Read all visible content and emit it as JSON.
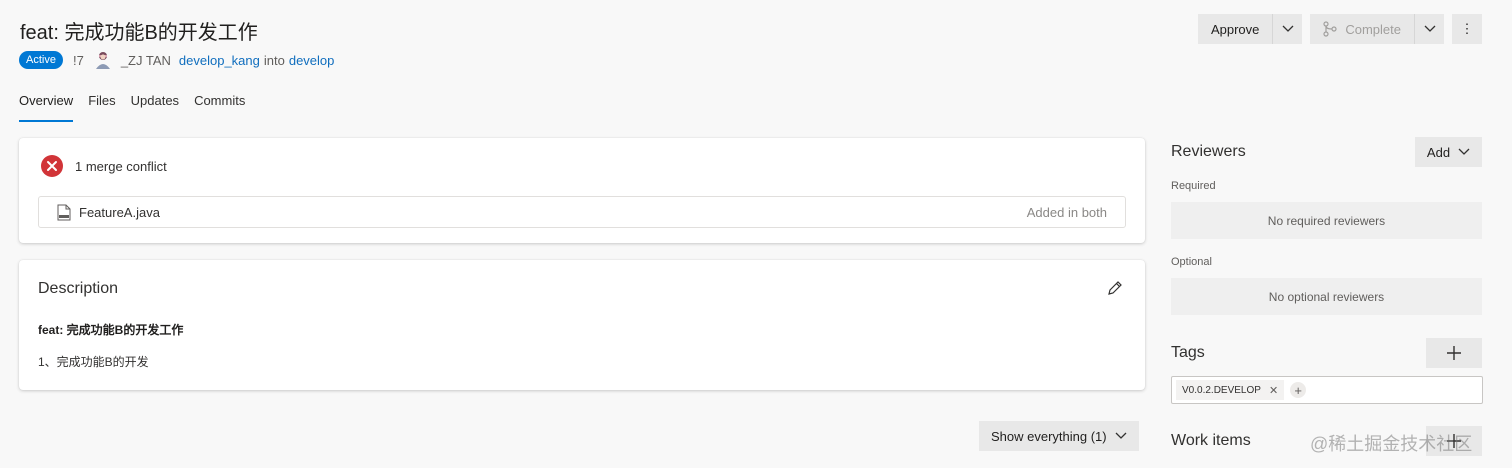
{
  "header": {
    "title": "feat: 完成功能B的开发工作",
    "status": "Active",
    "pr_id": "!7",
    "author": "_ZJ TAN",
    "source_branch": "develop_kang",
    "into_text": "into",
    "target_branch": "develop"
  },
  "actions": {
    "approve_label": "Approve",
    "complete_label": "Complete",
    "more_glyph": "⋮"
  },
  "tabs": [
    {
      "label": "Overview",
      "active": true
    },
    {
      "label": "Files",
      "active": false
    },
    {
      "label": "Updates",
      "active": false
    },
    {
      "label": "Commits",
      "active": false
    }
  ],
  "conflicts": {
    "summary": "1 merge conflict",
    "files": [
      {
        "name": "FeatureA.java",
        "status": "Added in both"
      }
    ]
  },
  "description": {
    "title": "Description",
    "body_title": "feat: 完成功能B的开发工作",
    "body_line": "1、完成功能B的开发"
  },
  "filter": {
    "show_label": "Show everything (1)"
  },
  "sidebar": {
    "reviewers_title": "Reviewers",
    "add_label": "Add",
    "required_label": "Required",
    "no_required": "No required reviewers",
    "optional_label": "Optional",
    "no_optional": "No optional reviewers",
    "tags_title": "Tags",
    "tags": [
      "V0.0.2.DEVELOP"
    ],
    "work_items_title": "Work items"
  },
  "watermark": "@稀土掘金技术社区",
  "colors": {
    "accent": "#0078d4",
    "link": "#106ebe",
    "error": "#d13438",
    "button_bg": "#e8e8e8",
    "page_bg": "#f8f8f8"
  },
  "icons": [
    "avatar-icon",
    "chevron-down-icon",
    "branch-merge-icon",
    "more-icon",
    "error-icon",
    "java-file-icon",
    "pencil-icon",
    "plus-icon",
    "close-icon"
  ]
}
